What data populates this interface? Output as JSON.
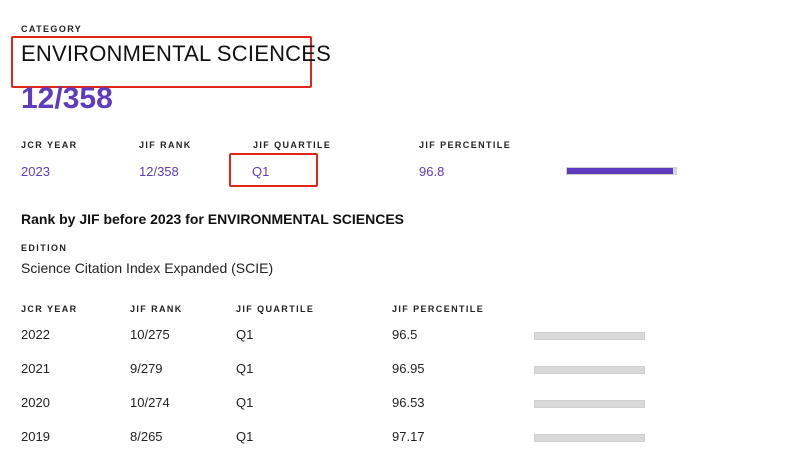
{
  "category": {
    "label": "CATEGORY",
    "name": "ENVIRONMENTAL SCIENCES",
    "rank": "12/358"
  },
  "current": {
    "headers": {
      "year": "JCR YEAR",
      "rank": "JIF RANK",
      "quartile": "JIF QUARTILE",
      "percentile": "JIF PERCENTILE"
    },
    "year": "2023",
    "rank": "12/358",
    "quartile": "Q1",
    "percentile": "96.8",
    "percentile_value": 96.8,
    "bar_color": "#5e3bbf"
  },
  "history": {
    "title": "Rank by JIF before 2023 for ENVIRONMENTAL SCIENCES",
    "edition_label": "EDITION",
    "edition": "Science Citation Index Expanded (SCIE)",
    "headers": {
      "year": "JCR YEAR",
      "rank": "JIF RANK",
      "quartile": "JIF QUARTILE",
      "percentile": "JIF PERCENTILE"
    },
    "rows": [
      {
        "year": "2022",
        "rank": "10/275",
        "quartile": "Q1",
        "percentile": "96.5"
      },
      {
        "year": "2021",
        "rank": "9/279",
        "quartile": "Q1",
        "percentile": "96.95"
      },
      {
        "year": "2020",
        "rank": "10/274",
        "quartile": "Q1",
        "percentile": "96.53"
      },
      {
        "year": "2019",
        "rank": "8/265",
        "quartile": "Q1",
        "percentile": "97.17"
      }
    ],
    "bar_color": "#d9d9d9"
  }
}
